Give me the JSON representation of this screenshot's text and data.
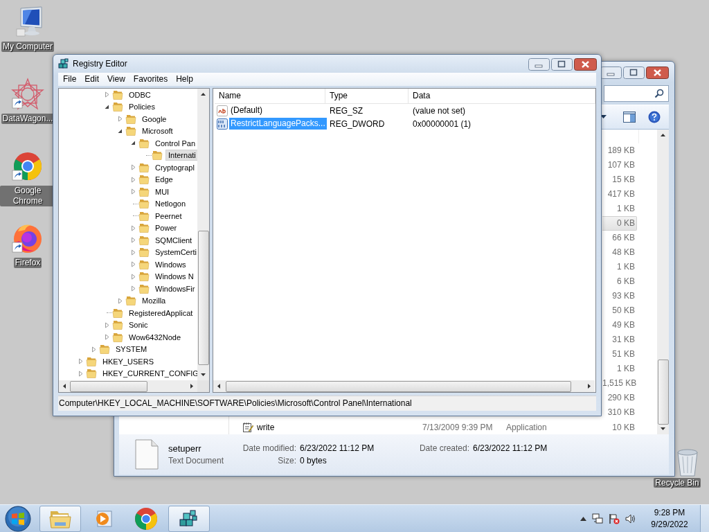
{
  "desktop_icons": [
    {
      "label": "My Computer",
      "kind": "computer",
      "shortcut": false
    },
    {
      "label": "DataWagon...",
      "kind": "star",
      "shortcut": true
    },
    {
      "label": "Google Chrome",
      "kind": "chrome",
      "shortcut": true
    },
    {
      "label": "Firefox",
      "kind": "firefox",
      "shortcut": true
    }
  ],
  "recycle_bin": {
    "label": "Recycle Bin"
  },
  "explorer": {
    "rows": [
      {
        "size": "189 KB",
        "selected": false
      },
      {
        "size": "107 KB",
        "selected": false
      },
      {
        "size": "15 KB",
        "selected": false
      },
      {
        "size": "417 KB",
        "selected": false
      },
      {
        "size": "1 KB",
        "selected": false
      },
      {
        "size": "0 KB",
        "selected": true
      },
      {
        "size": "66 KB",
        "selected": false
      },
      {
        "size": "48 KB",
        "selected": false
      },
      {
        "size": "1 KB",
        "selected": false
      },
      {
        "size": "6 KB",
        "selected": false
      },
      {
        "size": "93 KB",
        "selected": false
      },
      {
        "size": "50 KB",
        "selected": false
      },
      {
        "size": "49 KB",
        "selected": false
      },
      {
        "size": "31 KB",
        "selected": false
      },
      {
        "size": "51 KB",
        "selected": false
      },
      {
        "size": "1 KB",
        "selected": false
      },
      {
        "size": "1,515 KB",
        "selected": false
      },
      {
        "size": "290 KB",
        "selected": false
      },
      {
        "size": "310 KB",
        "selected": false
      },
      {
        "name": "write",
        "date": "7/13/2009 9:39 PM",
        "type": "Application",
        "size": "10 KB",
        "selected": false
      }
    ],
    "details": {
      "name": "setuperr",
      "type": "Text Document",
      "fields": [
        {
          "label": "Date modified:",
          "value": "6/23/2022 11:12 PM"
        },
        {
          "label": "Date created:",
          "value": "6/23/2022 11:12 PM"
        },
        {
          "label": "Size:",
          "value": "0 bytes"
        }
      ]
    }
  },
  "registry": {
    "title": "Registry Editor",
    "menu": [
      "File",
      "Edit",
      "View",
      "Favorites",
      "Help"
    ],
    "tree": [
      {
        "children": [
          {
            "children": [
              {
                "children": [
                  {
                    "label": "ODBC",
                    "kind": "branch",
                    "expanded": false,
                    "selected": false
                  },
                  {
                    "label": "Policies",
                    "kind": "branch",
                    "expanded": true,
                    "selected": false,
                    "children": [
                      {
                        "label": "Google",
                        "kind": "branch",
                        "expanded": false,
                        "selected": false
                      },
                      {
                        "label": "Microsoft",
                        "kind": "branch",
                        "expanded": true,
                        "selected": false,
                        "children": [
                          {
                            "label": "Control Pan",
                            "kind": "branch",
                            "expanded": true,
                            "selected": false,
                            "children": [
                              {
                                "label": "Internati",
                                "kind": "leaf",
                                "selected": true
                              }
                            ]
                          },
                          {
                            "label": "Cryptograpl",
                            "kind": "branch",
                            "expanded": false,
                            "selected": false
                          },
                          {
                            "label": "Edge",
                            "kind": "branch",
                            "expanded": false,
                            "selected": false
                          },
                          {
                            "label": "MUI",
                            "kind": "branch",
                            "expanded": false,
                            "selected": false
                          },
                          {
                            "label": "Netlogon",
                            "kind": "leaf",
                            "selected": false
                          },
                          {
                            "label": "Peernet",
                            "kind": "leaf",
                            "selected": false
                          },
                          {
                            "label": "Power",
                            "kind": "branch",
                            "expanded": false,
                            "selected": false
                          },
                          {
                            "label": "SQMClient",
                            "kind": "branch",
                            "expanded": false,
                            "selected": false
                          },
                          {
                            "label": "SystemCerti",
                            "kind": "branch",
                            "expanded": false,
                            "selected": false
                          },
                          {
                            "label": "Windows",
                            "kind": "branch",
                            "expanded": false,
                            "selected": false
                          },
                          {
                            "label": "Windows N",
                            "kind": "branch",
                            "expanded": false,
                            "selected": false
                          },
                          {
                            "label": "WindowsFir",
                            "kind": "branch",
                            "expanded": false,
                            "selected": false
                          }
                        ]
                      },
                      {
                        "label": "Mozilla",
                        "kind": "branch",
                        "expanded": false,
                        "selected": false
                      }
                    ]
                  },
                  {
                    "label": "RegisteredApplicat",
                    "kind": "leaf",
                    "selected": false
                  },
                  {
                    "label": "Sonic",
                    "kind": "branch",
                    "expanded": false,
                    "selected": false
                  },
                  {
                    "label": "Wow6432Node",
                    "kind": "branch",
                    "expanded": false,
                    "selected": false
                  }
                ]
              },
              {
                "label": "SYSTEM",
                "kind": "branch",
                "expanded": false,
                "selected": false
              }
            ]
          },
          {
            "label": "HKEY_USERS",
            "kind": "branch",
            "expanded": false,
            "selected": false
          },
          {
            "label": "HKEY_CURRENT_CONFIG",
            "kind": "branch",
            "expanded": false,
            "selected": false
          }
        ]
      }
    ],
    "columns": [
      "Name",
      "Type",
      "Data"
    ],
    "values": [
      {
        "kind": "string",
        "name": "(Default)",
        "type": "REG_SZ",
        "data": "(value not set)",
        "selected": false
      },
      {
        "kind": "binary",
        "name": "RestrictLanguagePacks...",
        "type": "REG_DWORD",
        "data": "0x00000001 (1)",
        "selected": true
      }
    ],
    "status": "Computer\\HKEY_LOCAL_MACHINE\\SOFTWARE\\Policies\\Microsoft\\Control Panel\\International"
  },
  "taskbar": {
    "items": [
      {
        "kind": "explorer",
        "open": true
      },
      {
        "kind": "media",
        "open": false
      },
      {
        "kind": "chrome",
        "open": false
      },
      {
        "kind": "regedit",
        "open": true
      }
    ],
    "time": "9:28 PM",
    "date": "9/29/2022"
  }
}
